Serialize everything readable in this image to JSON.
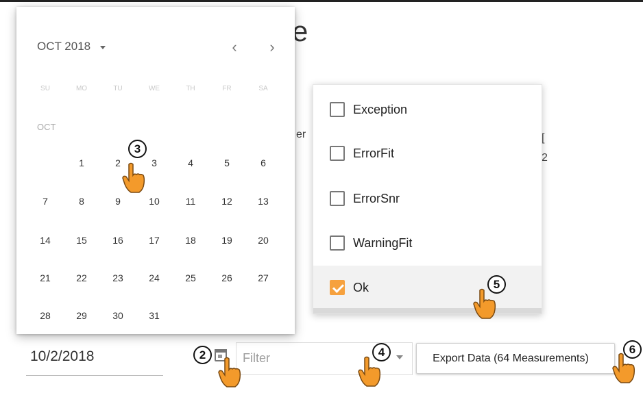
{
  "background": {
    "heading_fragment": "e",
    "fragment_right": "er",
    "fragment_far_right": "[",
    "fragment_far_right_2": "2",
    "date_value": "10/2/2018"
  },
  "datepicker": {
    "month_label": "OCT 2018",
    "prev_icon": "‹",
    "next_icon": "›",
    "weekdays": [
      "SU",
      "MO",
      "TU",
      "WE",
      "TH",
      "FR",
      "SA"
    ],
    "month_section_label": "OCT",
    "days": [
      "1",
      "2",
      "3",
      "4",
      "5",
      "6",
      "7",
      "8",
      "9",
      "10",
      "11",
      "12",
      "13",
      "14",
      "15",
      "16",
      "17",
      "18",
      "19",
      "20",
      "21",
      "22",
      "23",
      "24",
      "25",
      "26",
      "27",
      "28",
      "29",
      "30",
      "31"
    ],
    "selected_day": "2"
  },
  "filter": {
    "placeholder": "Filter",
    "options": [
      {
        "label": "Exception",
        "checked": false
      },
      {
        "label": "ErrorFit",
        "checked": false
      },
      {
        "label": "ErrorSnr",
        "checked": false
      },
      {
        "label": "WarningFit",
        "checked": false
      },
      {
        "label": "Ok",
        "checked": true
      }
    ]
  },
  "export": {
    "label": "Export Data (64 Measurements)"
  },
  "steps": [
    "2",
    "3",
    "4",
    "5",
    "6"
  ],
  "colors": {
    "accent": "#f6a13e",
    "hand": "#f39a2b"
  },
  "icons": [
    "calendar-icon",
    "chevron-left-icon",
    "chevron-right-icon",
    "dropdown-arrow-icon",
    "pointer-hand-icon",
    "checkbox-icon"
  ]
}
